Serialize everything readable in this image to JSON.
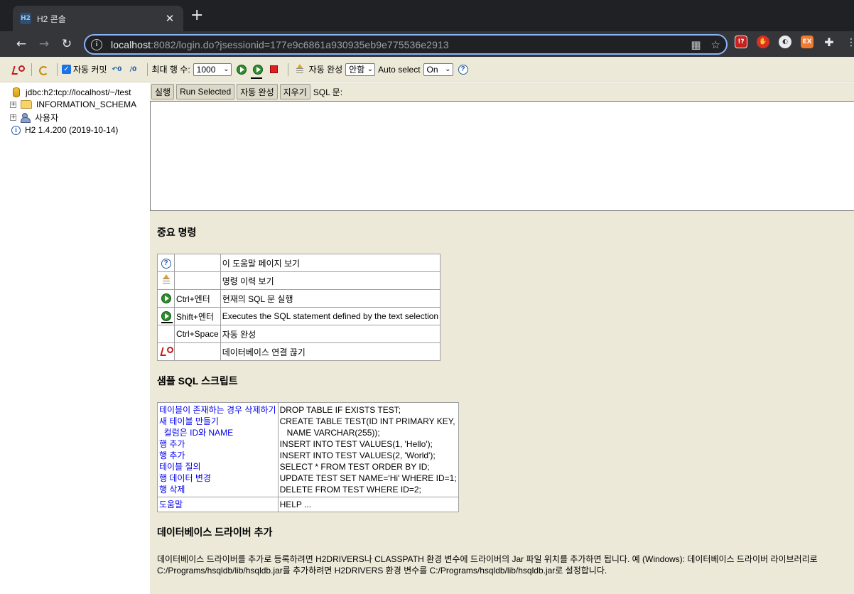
{
  "browser": {
    "tab_title": "H2 콘솔",
    "tab_close": "✕",
    "new_tab": "+",
    "url_host": "localhost",
    "url_rest": ":8082/login.do?jsessionid=177e9c6861a930935eb9e775536e2913",
    "ext_labels": [
      "!?",
      "✋",
      "◐",
      "EX",
      "✚"
    ]
  },
  "toolbar": {
    "autocommit_label": "자동 커밋",
    "maxrows_label": "최대 행 수:",
    "maxrows_value": "1000",
    "autocomplete_label": "자동 완성",
    "autocomplete_value": "안함",
    "autoselect_label": "Auto select",
    "autoselect_value": "On",
    "help_glyph": "?"
  },
  "tree": {
    "connection": "jdbc:h2:tcp://localhost/~/test",
    "schema": "INFORMATION_SCHEMA",
    "users": "사용자",
    "version": "H2 1.4.200 (2019-10-14)"
  },
  "sql": {
    "run_button": "실행",
    "run_selected_button": "Run Selected",
    "autocomplete_button": "자동 완성",
    "clear_button": "지우기",
    "label": "SQL 문:"
  },
  "help": {
    "important_title": "중요 명령",
    "commands": [
      {
        "icon": "help-icon",
        "key": "",
        "desc": "이 도움말 페이지 보기"
      },
      {
        "icon": "history-icon",
        "key": "",
        "desc": "명령 이력 보기"
      },
      {
        "icon": "run-icon",
        "key": "Ctrl+엔터",
        "desc": "현재의 SQL 문 실행"
      },
      {
        "icon": "run-selected-icon",
        "key": "Shift+엔터",
        "desc": "Executes the SQL statement defined by the text selection"
      },
      {
        "icon": "",
        "key": "Ctrl+Space",
        "desc": "자동 완성"
      },
      {
        "icon": "disconnect-icon",
        "key": "",
        "desc": "데이터베이스 연결 끊기"
      }
    ],
    "sample_title": "샘플 SQL 스크립트",
    "samples": [
      {
        "label": "테이블이 존재하는 경우 삭제하기",
        "sql": "DROP TABLE IF EXISTS TEST;"
      },
      {
        "label": "새 테이블 만들기",
        "sql": "CREATE TABLE TEST(ID INT PRIMARY KEY,"
      },
      {
        "label": "  컬럼은 ID와 NAME",
        "sql": "   NAME VARCHAR(255));"
      },
      {
        "label": "행 추가",
        "sql": "INSERT INTO TEST VALUES(1, 'Hello');"
      },
      {
        "label": "행 추가",
        "sql": "INSERT INTO TEST VALUES(2, 'World');"
      },
      {
        "label": "테이블 질의",
        "sql": "SELECT * FROM TEST ORDER BY ID;"
      },
      {
        "label": "행 데이터 변경",
        "sql": "UPDATE TEST SET NAME='Hi' WHERE ID=1;"
      },
      {
        "label": "행 삭제",
        "sql": "DELETE FROM TEST WHERE ID=2;"
      }
    ],
    "help_label": "도움말",
    "help_sql": "HELP ...",
    "driver_title": "데이터베이스 드라이버 추가",
    "driver_text_1": "데이터베이스 드라이버를 추가로 등록하려면 H2DRIVERS나 CLASSPATH 환경 변수에 드라이버의 Jar 파일 위치를 추가하면 됩니다. 예 (Windows): 데이터베이스 드라이버 라이브러리로",
    "driver_text_2": "C:/Programs/hsqldb/lib/hsqldb.jar를 추가하려면 H2DRIVERS 환경 변수를 C:/Programs/hsqldb/lib/hsqldb.jar로 설정합니다."
  },
  "colors": {
    "panel_bg": "#ece9d8",
    "link": "#0000ee",
    "omnibox_border": "#8ab4f8"
  }
}
